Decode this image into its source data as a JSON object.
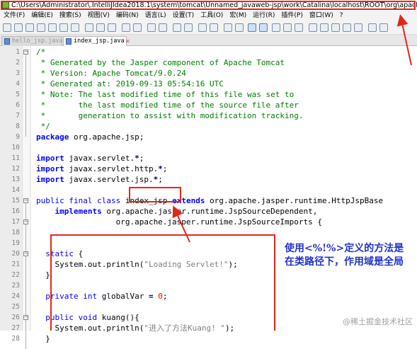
{
  "window": {
    "title_path": "C:\\Users\\Administrator\\.IntelliJIdea2018.1\\system\\tomcat\\Unnamed_javaweb-jsp\\work\\Catalina\\localhost\\ROOT\\org\\apache\\jsp\\index_jsp.ja"
  },
  "menu": [
    "文件(F)",
    "编辑(E)",
    "搜索(S)",
    "视图(V)",
    "编码(N)",
    "语言(L)",
    "设置(T)",
    "工具(O)",
    "宏(M)",
    "运行(R)",
    "插件(P)",
    "窗口(W)",
    "?"
  ],
  "tabs": [
    {
      "label": "hello_jsp.java",
      "active": false,
      "close": ""
    },
    {
      "label": "index_jsp.java",
      "active": true,
      "close": "☒"
    }
  ],
  "lines": [
    {
      "n": "1",
      "t": "/*"
    },
    {
      "n": "2",
      "t": " * Generated by the Jasper component of Apache Tomcat"
    },
    {
      "n": "3",
      "t": " * Version: Apache Tomcat/9.0.24"
    },
    {
      "n": "4",
      "t": " * Generated at: 2019-09-13 05:54:16 UTC"
    },
    {
      "n": "5",
      "t": " * Note: The last modified time of this file was set to"
    },
    {
      "n": "6",
      "t": " *       the last modified time of the source file after"
    },
    {
      "n": "7",
      "t": " *       generation to assist with modification tracking."
    },
    {
      "n": "8",
      "t": " */"
    },
    {
      "n": "9",
      "kw": "package",
      "rest": " org.apache.jsp;"
    },
    {
      "n": "10",
      "t": ""
    },
    {
      "n": "11",
      "kw": "import",
      "rest": " javax.servlet.",
      "star": "*",
      "end": ";"
    },
    {
      "n": "12",
      "kw": "import",
      "rest": " javax.servlet.http.",
      "star": "*",
      "end": ";"
    },
    {
      "n": "13",
      "kw": "import",
      "rest": " javax.servlet.jsp.",
      "star": "*",
      "end": ";"
    },
    {
      "n": "14",
      "t": ""
    },
    {
      "n": "15",
      "kwp": "public final class",
      "cls": " index_jsp ",
      "kw2": "extends",
      "rest": " org.apache.jasper.runtime.HttpJspBase"
    },
    {
      "n": "16",
      "kw": "    implements",
      "rest": " org.apache.jasper.runtime.JspSourceDependent,"
    },
    {
      "n": "17",
      "t": "                 org.apache.jasper.runtime.JspSourceImports {"
    },
    {
      "n": "18",
      "t": ""
    },
    {
      "n": "19",
      "t": ""
    },
    {
      "n": "20",
      "kwp": "  static",
      "rest": " {"
    },
    {
      "n": "21",
      "pre": "    System.out.println(",
      "str": "\"Loading Servlet!\"",
      "end": ");"
    },
    {
      "n": "22",
      "t": "  }"
    },
    {
      "n": "23",
      "t": ""
    },
    {
      "n": "24",
      "kwp": "  private int",
      "rest": " globalVar ",
      "op": "=",
      "num": " 0",
      "end": ";"
    },
    {
      "n": "25",
      "t": ""
    },
    {
      "n": "26",
      "kwp": "  public void",
      "rest": " kuang(){"
    },
    {
      "n": "27",
      "pre": "    System.out.println(",
      "str": "\"进入了方法Kuang! \"",
      "end": ");"
    },
    {
      "n": "28",
      "t": "  }"
    }
  ],
  "annotation": "使用<%!%>定义的方法是在类路径下，作用域是全局",
  "watermark": "@稀土掘金技术社区",
  "colors": {
    "highlight_box": "#e32619",
    "annotation_text": "#2233cc",
    "comment": "#008000",
    "keyword": "#0000ff"
  }
}
